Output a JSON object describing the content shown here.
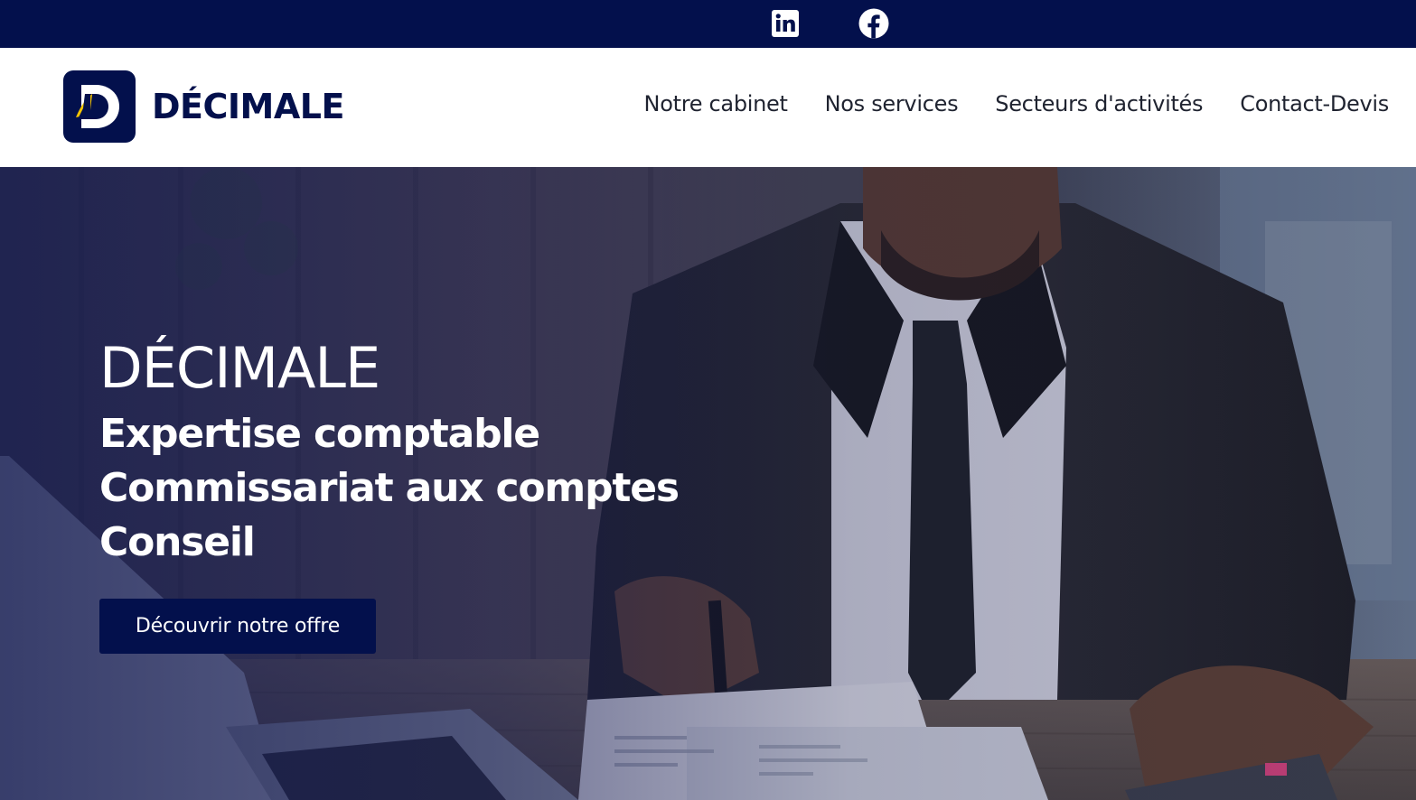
{
  "topbar": {
    "linkedin_icon": "linkedin-icon",
    "facebook_icon": "facebook-icon"
  },
  "header": {
    "logo_text": "DÉCIMALE",
    "nav": [
      {
        "label": "Notre cabinet"
      },
      {
        "label": "Nos services"
      },
      {
        "label": "Secteurs d'activités"
      },
      {
        "label": "Contact-Devis"
      }
    ]
  },
  "hero": {
    "title": "DÉCIMALE",
    "lines": [
      "Expertise comptable",
      "Commissariat aux comptes",
      "Conseil"
    ],
    "cta_label": "Découvrir notre offre"
  },
  "colors": {
    "brand_navy": "#03104c",
    "brand_yellow": "#f5c400",
    "text_dark": "#1f2330",
    "white": "#ffffff"
  }
}
